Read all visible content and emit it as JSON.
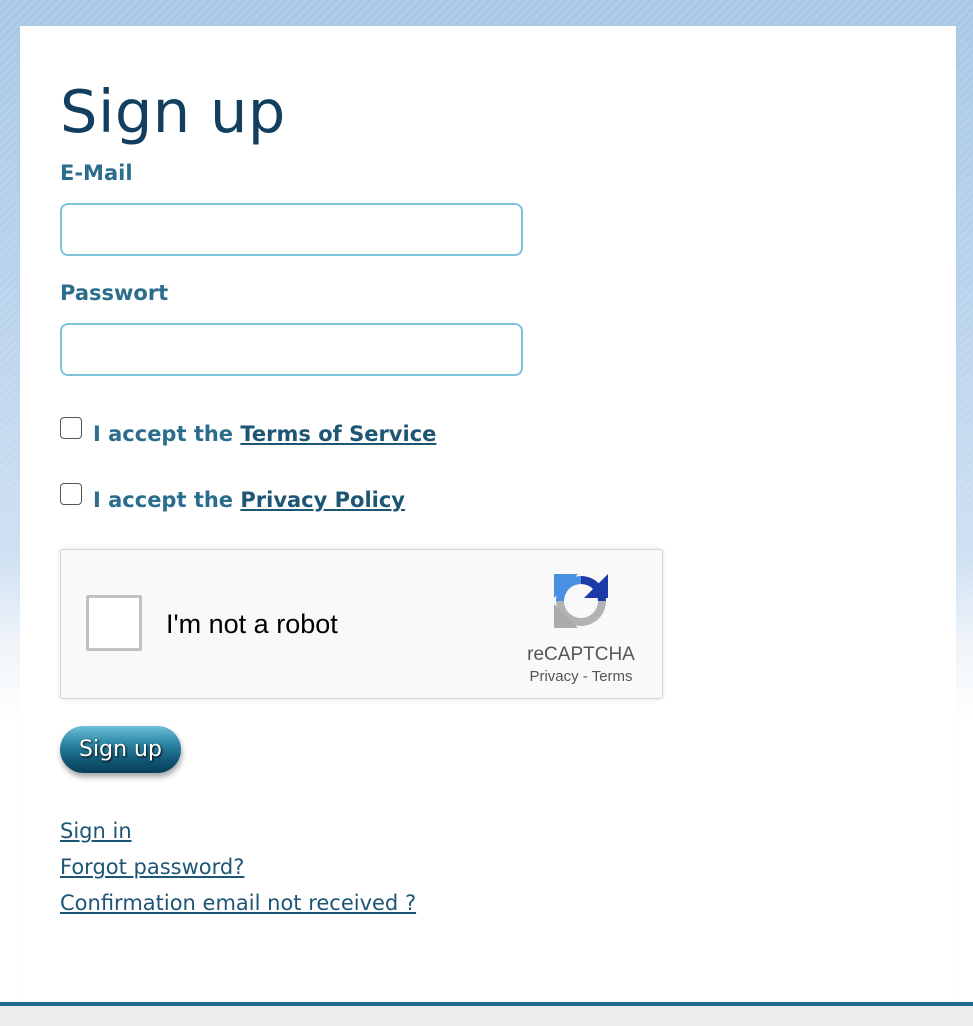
{
  "form": {
    "title": "Sign up",
    "email_label": "E-Mail",
    "email_value": "",
    "password_label": "Passwort",
    "password_value": "",
    "terms": {
      "prefix": "I accept the",
      "link": "Terms of Service",
      "checked": false
    },
    "privacy": {
      "prefix": "I accept the",
      "link": "Privacy Policy",
      "checked": false
    },
    "recaptcha": {
      "label": "I'm not a robot",
      "brand": "reCAPTCHA",
      "privacy": "Privacy",
      "separator": "-",
      "terms": "Terms",
      "icon": "recaptcha-logo-icon"
    },
    "submit_label": "Sign up"
  },
  "links": {
    "sign_in": "Sign in",
    "forgot_password": "Forgot password?",
    "confirmation": "Confirmation email not received ?"
  },
  "colors": {
    "heading": "#123f5f",
    "label": "#2a6d8d",
    "link": "#1d5674",
    "input_border": "#7ec3dc",
    "footer_bar": "#216a8a"
  }
}
